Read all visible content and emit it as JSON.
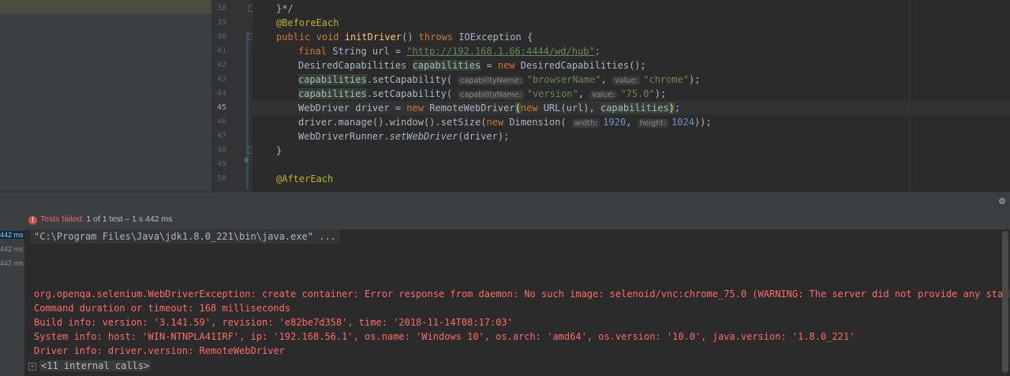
{
  "editor": {
    "line_numbers": [
      "38",
      "39",
      "40",
      "41",
      "42",
      "43",
      "44",
      "45",
      "46",
      "47",
      "48",
      "49",
      "50"
    ],
    "current_line": "45",
    "code": {
      "l38": "}*/",
      "l39_annotation": "@BeforeEach",
      "l40_public": "public",
      "l40_void": "void",
      "l40_name": "initDriver",
      "l40_parens": "() ",
      "l40_throws": "throws",
      "l40_rest": " IOException {",
      "l41_final": "final",
      "l41_mid": " String url = ",
      "l41_url": "\"http://192.168.1.66:4444/wd/hub\"",
      "l41_end": ";",
      "l42_a": "DesiredCapabilities ",
      "l42_var": "capabilities",
      "l42_b": " = ",
      "l42_new": "new",
      "l42_c": " DesiredCapabilities();",
      "l43_var": "capabilities",
      "l43_a": ".setCapability( ",
      "l43_hint1": "capabilityName:",
      "l43_s1": "\"browserName\"",
      "l43_comma": ", ",
      "l43_hint2": "value:",
      "l43_s2": "\"chrome\"",
      "l43_end": ");",
      "l44_var": "capabilities",
      "l44_a": ".setCapability( ",
      "l44_hint1": "capabilityName:",
      "l44_s1": "\"version\"",
      "l44_comma": ", ",
      "l44_hint2": "value:",
      "l44_s2": "\"75.0\"",
      "l44_end": ");",
      "l45_a": "WebDriver driver = ",
      "l45_new": "new",
      "l45_b": " RemoteWebDriver",
      "l45_paren": "(",
      "l45_new2": "new",
      "l45_c": " URL(url), ",
      "l45_var": "capabilities",
      "l45_paren2": ")",
      "l45_end": ";",
      "l46_a": "driver.manage().window().setSize(",
      "l46_new": "new",
      "l46_b": " Dimension( ",
      "l46_hint1": "width:",
      "l46_n1": "1920",
      "l46_comma": ", ",
      "l46_hint2": "height:",
      "l46_n2": "1024",
      "l46_end": "));",
      "l47_a": "WebDriverRunner.",
      "l47_method": "setWebDriver",
      "l47_end": "(driver);",
      "l48": "}",
      "l50_annotation": "@AfterEach"
    }
  },
  "test_status": {
    "label": "Tests failed:",
    "detail": " 1 of 1 test – 1 s 442 ms"
  },
  "tree_times": [
    "442 ms",
    "442 ms",
    "442 ms"
  ],
  "console": {
    "command": "\"C:\\Program Files\\Java\\jdk1.8.0_221\\bin\\java.exe\" ...",
    "lines": [
      "org.openqa.selenium.WebDriverException: create container: Error response from daemon: No such image: selenoid/vnc:chrome_75.0 (WARNING: The server did not provide any stacktrace i",
      "Command duration or timeout: 168 milliseconds",
      "Build info: version: '3.141.59', revision: 'e82be7d358', time: '2018-11-14T08:17:03'",
      "System info: host: 'WIN-NTNPLA41IRF', ip: '192.168.56.1', os.name: 'Windows 10', os.arch: 'amd64', os.version: '10.0', java.version: '1.8.0_221'",
      "Driver info: driver.version: RemoteWebDriver"
    ],
    "internal_calls": "<11 internal calls>"
  },
  "icons": {
    "settings": "gear-icon",
    "error": "error-icon"
  }
}
